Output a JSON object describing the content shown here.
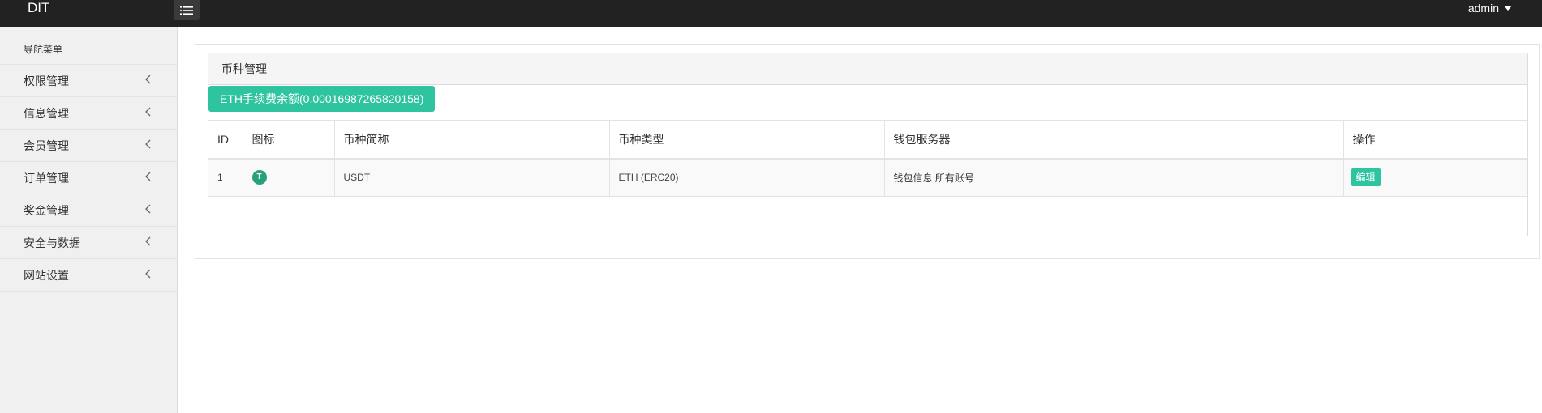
{
  "header": {
    "brand": "DIT",
    "user": "admin"
  },
  "sidebar": {
    "title": "导航菜单",
    "items": [
      {
        "label": "权限管理"
      },
      {
        "label": "信息管理"
      },
      {
        "label": "会员管理"
      },
      {
        "label": "订单管理"
      },
      {
        "label": "奖金管理"
      },
      {
        "label": "安全与数据"
      },
      {
        "label": "网站设置"
      }
    ]
  },
  "main": {
    "panel_title": "币种管理",
    "eth_fee_button": "ETH手续费余额(0.00016987265820158)",
    "table": {
      "headers": {
        "id": "ID",
        "icon": "图标",
        "short_name": "币种简称",
        "type": "币种类型",
        "wallet": "钱包服务器",
        "action": "操作"
      },
      "rows": [
        {
          "id": "1",
          "icon_glyph": "T",
          "short_name": "USDT",
          "type": "ETH (ERC20)",
          "wallet_info": "钱包信息",
          "all_accounts": "所有账号",
          "edit": "编辑"
        }
      ]
    }
  },
  "colors": {
    "topbar": "#222222",
    "accent": "#2ec4a0",
    "tether": "#26a17b"
  }
}
